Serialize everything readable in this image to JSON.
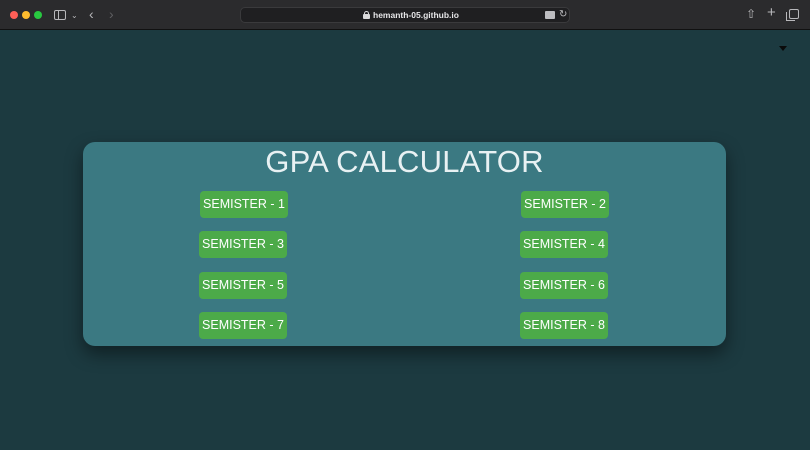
{
  "browser": {
    "url": "hemanth-05.github.io"
  },
  "page": {
    "title": "GPA CALCULATOR",
    "semesters": [
      "SEMISTER - 1",
      "SEMISTER - 2",
      "SEMISTER - 3",
      "SEMISTER - 4",
      "SEMISTER - 5",
      "SEMISTER - 6",
      "SEMISTER - 7",
      "SEMISTER - 8"
    ]
  },
  "colors": {
    "page_background": "#1c3a40",
    "card_background": "#3b7982",
    "button_green": "#4caa49"
  }
}
